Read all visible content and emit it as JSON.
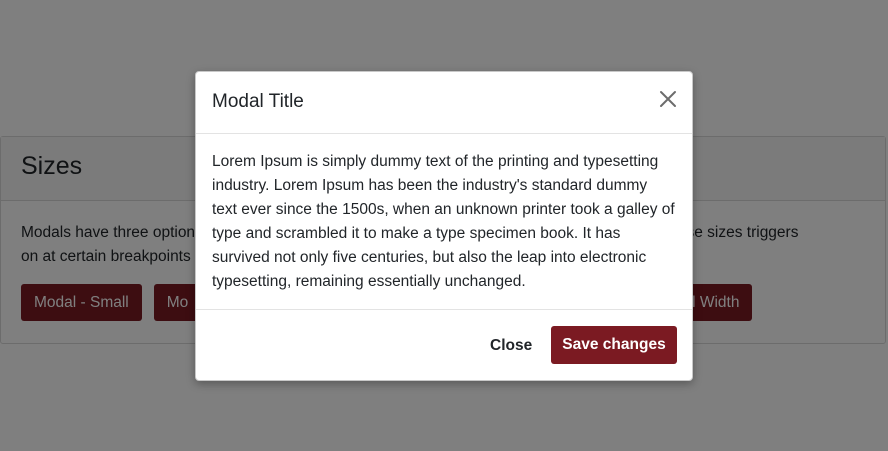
{
  "page": {
    "section_title": "Sizes",
    "description_start": "Modals have three options",
    "description_link": "g",
    "description_end": ". These sizes triggers",
    "description_line2": "on at certain breakpoints",
    "buttons": [
      {
        "label": "Modal - Small"
      },
      {
        "label": "Mo"
      },
      {
        "label": "ull Width"
      }
    ]
  },
  "modal": {
    "title": "Modal Title",
    "body": "Lorem Ipsum is simply dummy text of the printing and typesetting industry. Lorem Ipsum has been the industry's standard dummy text ever since the 1500s, when an unknown printer took a galley of type and scrambled it to make a type specimen book. It has survived not only five centuries, but also the leap into electronic typesetting, remaining essentially unchanged.",
    "close_icon": "close-icon",
    "close_label": "Close",
    "save_label": "Save changes"
  },
  "colors": {
    "primary": "#7b1a22",
    "backdrop": "rgba(0,0,0,0.5)"
  }
}
